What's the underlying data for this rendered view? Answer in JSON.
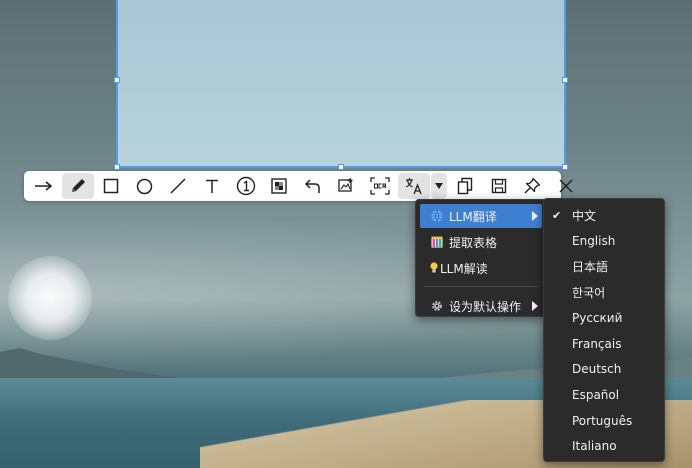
{
  "toolbar": {
    "tools": [
      {
        "name": "arrow-tool",
        "icon": "arrow-right-icon"
      },
      {
        "name": "pen-tool",
        "icon": "pencil-icon",
        "active": true
      },
      {
        "name": "rectangle-tool",
        "icon": "rectangle-icon"
      },
      {
        "name": "ellipse-tool",
        "icon": "ellipse-icon"
      },
      {
        "name": "line-tool",
        "icon": "line-icon"
      },
      {
        "name": "text-tool",
        "icon": "text-icon",
        "label": "T"
      },
      {
        "name": "number-marker-tool",
        "icon": "circled-number-icon",
        "label": "1"
      },
      {
        "name": "mosaic-tool",
        "icon": "mosaic-icon"
      },
      {
        "name": "undo-button",
        "icon": "undo-icon"
      },
      {
        "name": "image-edit-button",
        "icon": "image-edit-icon"
      },
      {
        "name": "ocr-button",
        "icon": "ocr-icon",
        "label": "OCR"
      },
      {
        "name": "translate-button",
        "icon": "translate-icon"
      },
      {
        "name": "translate-dropdown-button",
        "icon": "triangle-down-icon"
      },
      {
        "name": "copy-button",
        "icon": "copy-icon"
      },
      {
        "name": "save-button",
        "icon": "save-icon"
      },
      {
        "name": "pin-button",
        "icon": "pin-icon"
      },
      {
        "name": "close-button",
        "icon": "close-icon"
      }
    ]
  },
  "menu": {
    "items": [
      {
        "label": "LLM翻译",
        "icon": "globe-icon",
        "has_submenu": true,
        "highlighted": true
      },
      {
        "label": "提取表格",
        "icon": "table-icon"
      },
      {
        "label": "LLM解读",
        "icon": "lightbulb-icon"
      },
      {
        "label": "设为默认操作",
        "icon": "gear-icon",
        "has_submenu": true
      }
    ]
  },
  "languages": {
    "items": [
      {
        "label": "中文",
        "checked": true
      },
      {
        "label": "English"
      },
      {
        "label": "日本語"
      },
      {
        "label": "한국어"
      },
      {
        "label": "Русский"
      },
      {
        "label": "Français"
      },
      {
        "label": "Deutsch"
      },
      {
        "label": "Español"
      },
      {
        "label": "Português"
      },
      {
        "label": "Italiano"
      }
    ],
    "check_glyph": "✔"
  },
  "colors": {
    "selection_border": "#4d9cf0",
    "menu_background": "#2b2b2b",
    "menu_highlight": "#3f7fcf"
  }
}
